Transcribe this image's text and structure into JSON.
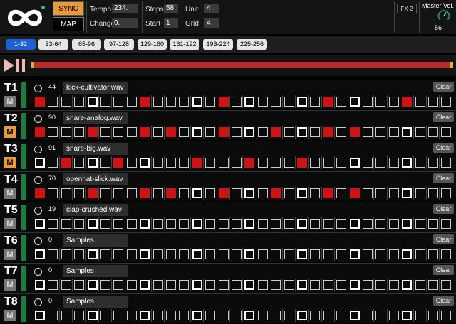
{
  "header": {
    "sync_label": "SYNC",
    "map_label": "MAP",
    "tempo_label": "Tempo",
    "tempo_value": "234.",
    "change_label": "Change",
    "change_value": "0.",
    "steps_label": "Steps",
    "steps_value": "58",
    "start_label": "Start",
    "start_value": "1",
    "unit_label": "Unit:",
    "unit_value": "4",
    "grid_label": "Grid",
    "grid_value": "4",
    "fx_label": "FX 2",
    "master_label": "Master Vol.",
    "master_value": "56"
  },
  "pages": [
    "1-32",
    "33-64",
    "65-96",
    "97-128",
    "129-160",
    "161-192",
    "193-224",
    "225-256"
  ],
  "active_page": 0,
  "progress": 1.0,
  "clear_label": "Clear",
  "mute_label": "M",
  "tracks": [
    {
      "label": "T1",
      "volume": "44",
      "sample": "kick-cultivator.wav",
      "muted": false
    },
    {
      "label": "T2",
      "volume": "90",
      "sample": "snare-analog.wav",
      "muted": true
    },
    {
      "label": "T3",
      "volume": "91",
      "sample": "snare-big.wav",
      "muted": true
    },
    {
      "label": "T4",
      "volume": "70",
      "sample": "openhat-slick.wav",
      "muted": false
    },
    {
      "label": "T5",
      "volume": "19",
      "sample": "clap-crushed.wav",
      "muted": false
    },
    {
      "label": "T6",
      "volume": "0",
      "sample": "Samples",
      "muted": false
    },
    {
      "label": "T7",
      "volume": "0",
      "sample": "Samples",
      "muted": false
    },
    {
      "label": "T8",
      "volume": "0",
      "sample": "Samples",
      "muted": false
    }
  ],
  "step_count": 32,
  "beat_steps": [
    0,
    4,
    8,
    12,
    16,
    20,
    24,
    28
  ],
  "active_steps": [
    [
      0,
      8,
      14,
      22,
      28
    ],
    [
      0,
      4,
      8,
      10,
      14,
      18,
      22,
      24
    ],
    [
      2,
      6,
      12,
      16,
      20
    ],
    [
      0,
      4,
      8,
      10,
      14,
      18,
      22,
      24
    ],
    [],
    [],
    [],
    []
  ],
  "colors": {
    "accent_orange": "#e69a3a",
    "step_on": "#cc1414",
    "page_active": "#1c5fd6",
    "meter_green": "#1f7a3f",
    "progress": "#c0282a"
  },
  "icons": [
    "infinity-logo-icon",
    "play-pause-icon",
    "record-circle-icon",
    "knob-icon"
  ]
}
